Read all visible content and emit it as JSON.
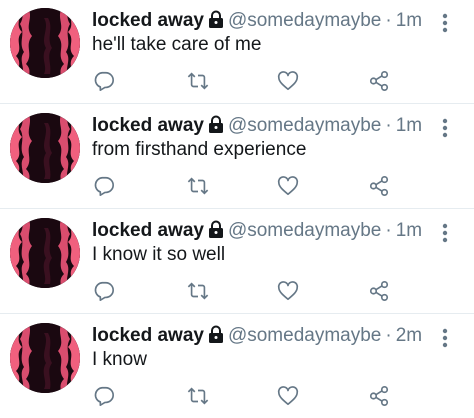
{
  "accent_color": "#657786",
  "icons": {
    "lock": "lock-icon",
    "more": "more-vertical-icon",
    "reply": "reply-icon",
    "retweet": "retweet-icon",
    "like": "heart-icon",
    "share": "share-icon"
  },
  "tweets": [
    {
      "name": "locked away",
      "handle": "@somedaymaybe",
      "separator": "·",
      "time": "1m",
      "text": "he'll take care of me"
    },
    {
      "name": "locked away",
      "handle": "@somedaymaybe",
      "separator": "·",
      "time": "1m",
      "text": "from firsthand experience"
    },
    {
      "name": "locked away",
      "handle": "@somedaymaybe",
      "separator": "·",
      "time": "1m",
      "text": "I know it so well"
    },
    {
      "name": "locked away",
      "handle": "@somedaymaybe",
      "separator": "·",
      "time": "2m",
      "text": "I know"
    }
  ]
}
